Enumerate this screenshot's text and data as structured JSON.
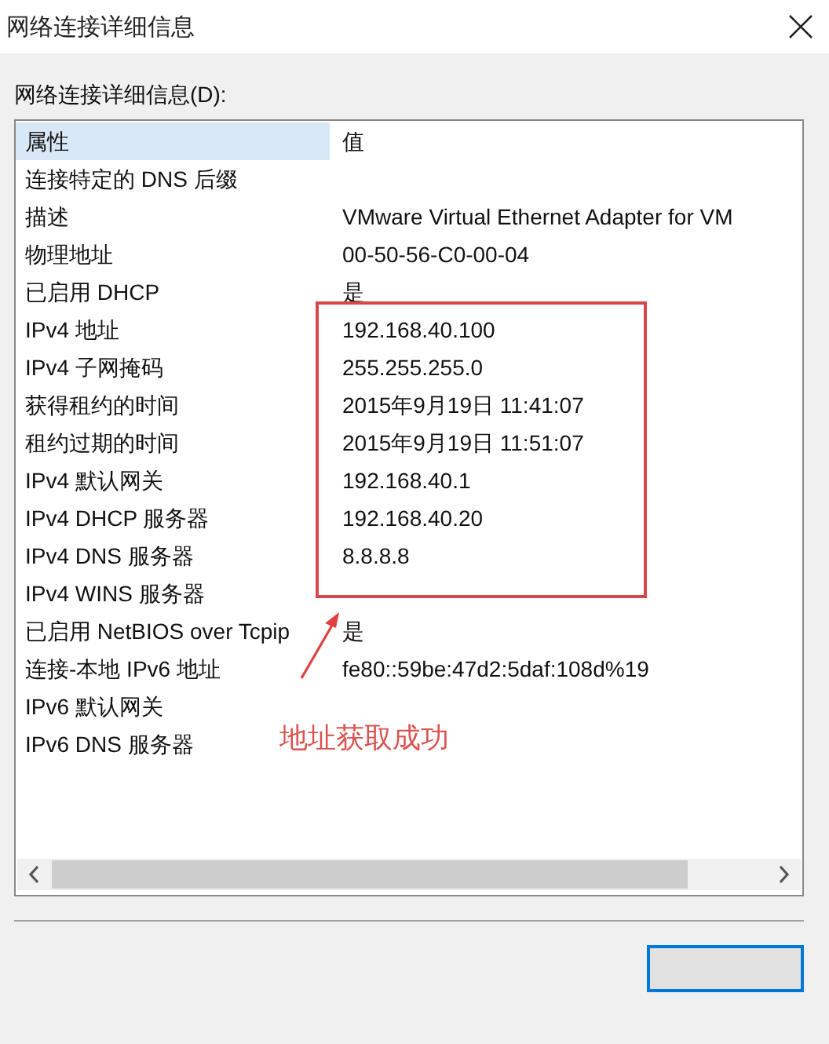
{
  "window": {
    "title": "网络连接详细信息"
  },
  "list_label": "网络连接详细信息(D):",
  "columns": [
    "属性",
    "值"
  ],
  "rows": [
    {
      "property": "连接特定的 DNS 后缀"
    },
    {
      "property": "描述",
      "value": "VMware Virtual Ethernet Adapter for VM"
    },
    {
      "property": "物理地址",
      "value": "00-50-56-C0-00-04"
    },
    {
      "property": "已启用 DHCP",
      "value": "是"
    },
    {
      "property": "IPv4 地址",
      "value": "192.168.40.100"
    },
    {
      "property": "IPv4 子网掩码",
      "value": "255.255.255.0"
    },
    {
      "property": "获得租约的时间",
      "value": "2015年9月19日 11:41:07"
    },
    {
      "property": "租约过期的时间",
      "value": "2015年9月19日 11:51:07"
    },
    {
      "property": "IPv4 默认网关",
      "value": "192.168.40.1"
    },
    {
      "property": "IPv4 DHCP 服务器",
      "value": "192.168.40.20"
    },
    {
      "property": "IPv4 DNS 服务器",
      "value": "8.8.8.8"
    },
    {
      "property": "IPv4 WINS 服务器"
    },
    {
      "property": "已启用 NetBIOS over Tcpip",
      "value": "是"
    },
    {
      "property": "连接-本地 IPv6 地址",
      "value": "fe80::59be:47d2:5daf:108d%19"
    },
    {
      "property": "IPv6 默认网关"
    },
    {
      "property": "IPv6 DNS 服务器"
    }
  ],
  "annotation": {
    "text": "地址获取成功"
  }
}
